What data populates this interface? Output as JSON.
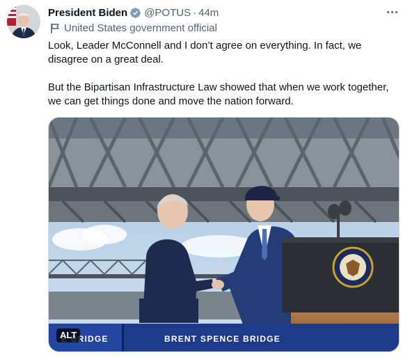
{
  "author": {
    "display_name": "President Biden",
    "handle": "@POTUS",
    "separator": "·",
    "time": "44m",
    "label": "United States government official",
    "avatar_icon": "avatar-photo",
    "verified_color": "#829aab"
  },
  "tweet": {
    "paragraphs": [
      "Look, Leader McConnell and I don’t agree on everything. In fact, we disagree on a great deal.",
      "But the Bipartisan Infrastructure Law showed that when we work together, we can get things done and move the nation forward."
    ]
  },
  "media": {
    "alt_badge": "ALT",
    "banner_left": "E BRIDGE",
    "banner_right": "BRENT SPENCE BRIDGE",
    "seal_text": "PRESIDENT OF THE UNITED STATES"
  },
  "colors": {
    "text_primary": "#0f1419",
    "text_secondary": "#536471",
    "border": "#cfd9de"
  }
}
